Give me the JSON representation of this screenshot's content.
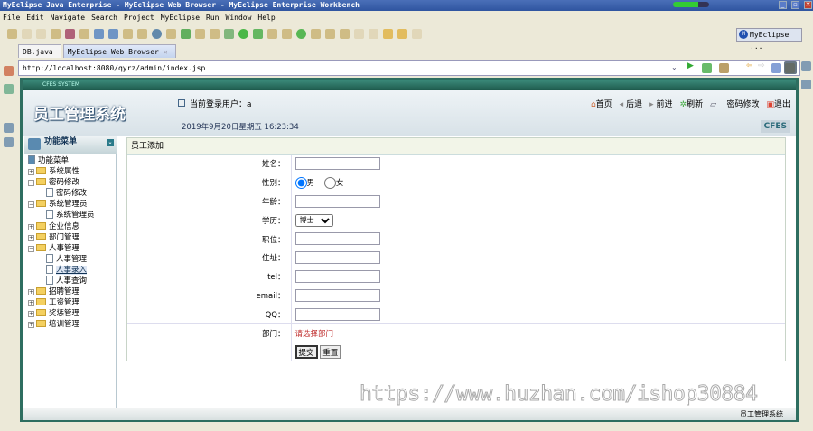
{
  "window": {
    "title": "MyEclipse Java Enterprise - MyEclipse Web Browser - MyEclipse Enterprise Workbench",
    "minimize": "_",
    "restore": "▫",
    "close": "✕"
  },
  "menu": [
    "File",
    "Edit",
    "Navigate",
    "Search",
    "Project",
    "MyEclipse",
    "Run",
    "Window",
    "Help"
  ],
  "perspective": "MyEclipse ...",
  "tabs": [
    {
      "label": "DB.java"
    },
    {
      "label": "MyEclipse Web Browser",
      "close": "✕"
    }
  ],
  "browser": {
    "url": "http://localhost:8080/qyrz/admin/index.jsp"
  },
  "app": {
    "system_bar": "CFES SYSTEM",
    "logo": "员工管理系统",
    "current_user": "当前登录用户：a",
    "nav": [
      "首页",
      "后退",
      "前进",
      "刷新",
      "密码修改",
      "退出"
    ],
    "datetime": "2019年9月20日星期五  16:23:34",
    "brand": "CFES",
    "sidebar": {
      "title": "功能菜单",
      "root": "功能菜单",
      "tree": [
        {
          "label": "系统属性",
          "expanded": false,
          "children": []
        },
        {
          "label": "密码修改",
          "expanded": true,
          "children": [
            "密码修改"
          ]
        },
        {
          "label": "系统管理员",
          "expanded": true,
          "children": [
            "系统管理员"
          ]
        },
        {
          "label": "企业信息",
          "expanded": false,
          "children": []
        },
        {
          "label": "部门管理",
          "expanded": false,
          "children": []
        },
        {
          "label": "人事管理",
          "expanded": true,
          "children": [
            "人事管理",
            "人事录入",
            "人事查询"
          ]
        },
        {
          "label": "招聘管理",
          "expanded": false,
          "children": []
        },
        {
          "label": "工资管理",
          "expanded": false,
          "children": []
        },
        {
          "label": "奖惩管理",
          "expanded": false,
          "children": []
        },
        {
          "label": "培训管理",
          "expanded": false,
          "children": []
        }
      ],
      "selected": "人事录入"
    },
    "form": {
      "title": "员工添加",
      "labels": {
        "name": "姓名：",
        "gender": "性别：",
        "age": "年龄：",
        "education": "学历：",
        "position": "职位：",
        "address": "住址：",
        "tel": "tel：",
        "email": "email：",
        "qq": "QQ：",
        "dept": "部门："
      },
      "gender_options": [
        "男",
        "女"
      ],
      "gender_selected": "男",
      "education_selected": "博士",
      "dept_hint": "请选择部门",
      "submit": "提交",
      "reset": "重置"
    },
    "footer": "员工管理系统"
  },
  "watermark": "https://www.huzhan.com/ishop30884"
}
